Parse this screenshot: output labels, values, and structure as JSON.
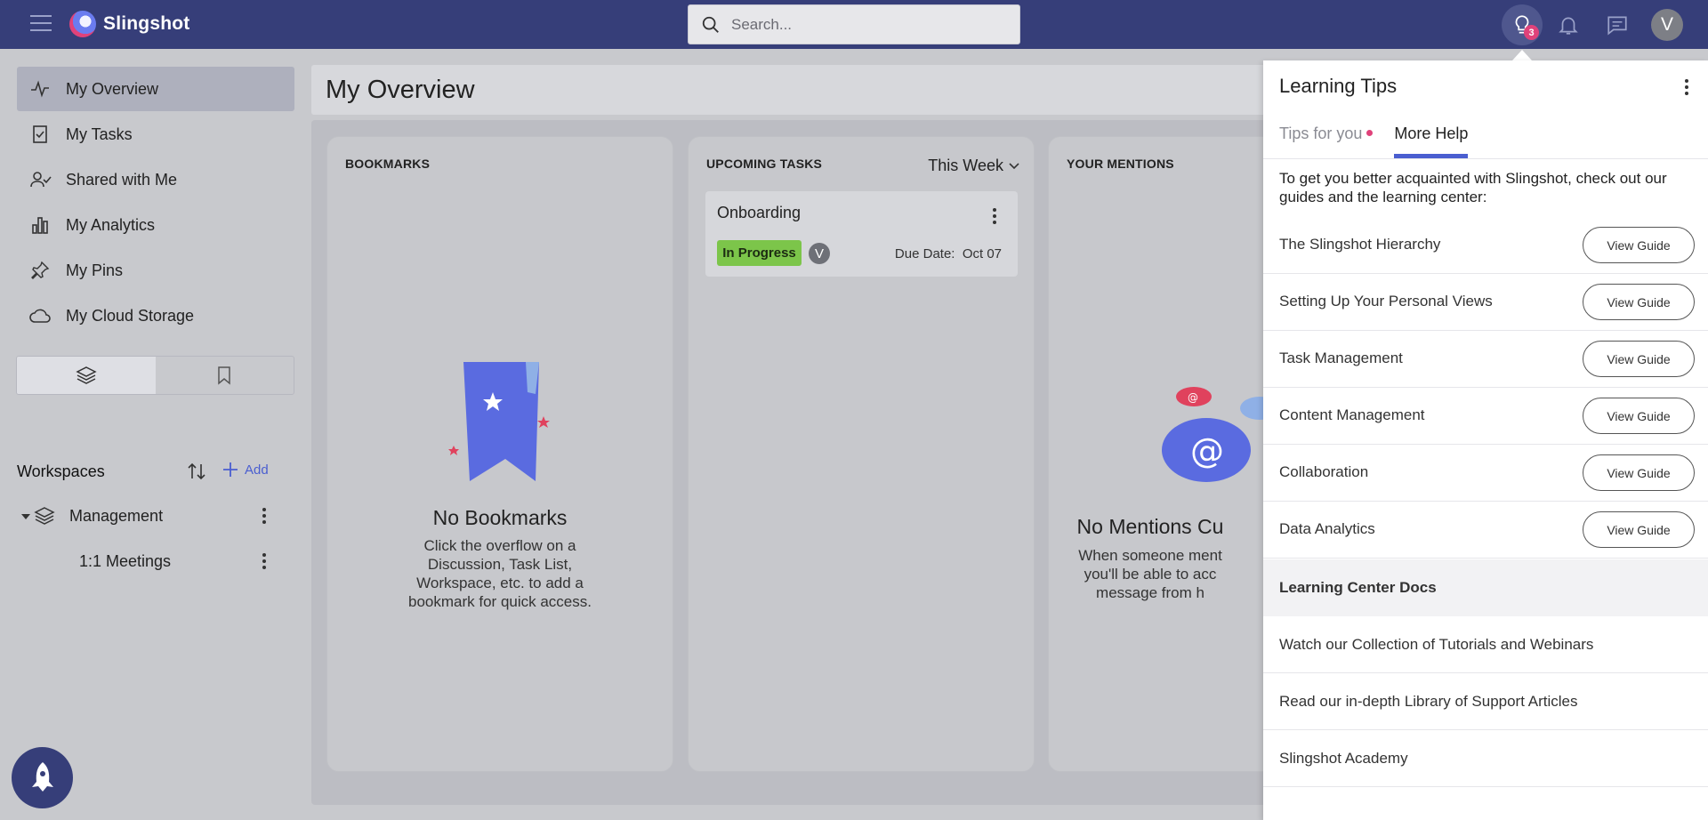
{
  "app": {
    "name": "Slingshot"
  },
  "search": {
    "placeholder": "Search..."
  },
  "topbar": {
    "tips_badge": "3",
    "user_initial": "V"
  },
  "sidebar": {
    "items": [
      {
        "label": "My Overview",
        "icon": "pulse-icon",
        "active": true
      },
      {
        "label": "My Tasks",
        "icon": "task-check-icon"
      },
      {
        "label": "Shared with Me",
        "icon": "user-check-icon"
      },
      {
        "label": "My Analytics",
        "icon": "bar-chart-icon"
      },
      {
        "label": "My Pins",
        "icon": "pin-icon"
      },
      {
        "label": "My Cloud Storage",
        "icon": "cloud-icon"
      }
    ],
    "workspaces_label": "Workspaces",
    "add_label": "Add",
    "tree": [
      {
        "label": "Management"
      },
      {
        "label": "1:1 Meetings"
      }
    ]
  },
  "main": {
    "title": "My Overview",
    "bookmarks": {
      "title": "BOOKMARKS",
      "empty_title": "No Bookmarks",
      "empty_lines": [
        "Click the overflow on a",
        "Discussion, Task List,",
        "Workspace, etc. to add a",
        "bookmark for quick access."
      ]
    },
    "tasks": {
      "title": "UPCOMING TASKS",
      "filter": "This Week",
      "task_name": "Onboarding",
      "status": "In Progress",
      "assignee_initial": "V",
      "due_label": "Due Date:",
      "due_value": "Oct 07"
    },
    "mentions": {
      "title": "YOUR MENTIONS",
      "empty_title": "No Mentions Cu",
      "empty_lines": [
        "When someone ment",
        "you'll be able to acc",
        "message from h"
      ]
    }
  },
  "tips_panel": {
    "title": "Learning Tips",
    "tabs": [
      {
        "label": "Tips for you",
        "active": false,
        "has_dot": true
      },
      {
        "label": "More Help",
        "active": true
      }
    ],
    "intro": "To get you better acquainted with Slingshot, check out our guides and the learning center:",
    "guides": [
      {
        "label": "The Slingshot Hierarchy",
        "button": "View Guide"
      },
      {
        "label": "Setting Up Your Personal Views",
        "button": "View Guide"
      },
      {
        "label": "Task Management",
        "button": "View Guide"
      },
      {
        "label": "Content Management",
        "button": "View Guide"
      },
      {
        "label": "Collaboration",
        "button": "View Guide"
      },
      {
        "label": "Data Analytics",
        "button": "View Guide"
      }
    ],
    "section_title": "Learning Center Docs",
    "links": [
      {
        "label": "Watch our Collection of Tutorials and Webinars"
      },
      {
        "label": "Read our in-depth Library of Support Articles"
      },
      {
        "label": "Slingshot Academy"
      }
    ]
  },
  "colors": {
    "topbar": "#363e79",
    "accent": "#4a5ed0",
    "status_green": "#7cc54a",
    "badge_pink": "#e0427a"
  }
}
